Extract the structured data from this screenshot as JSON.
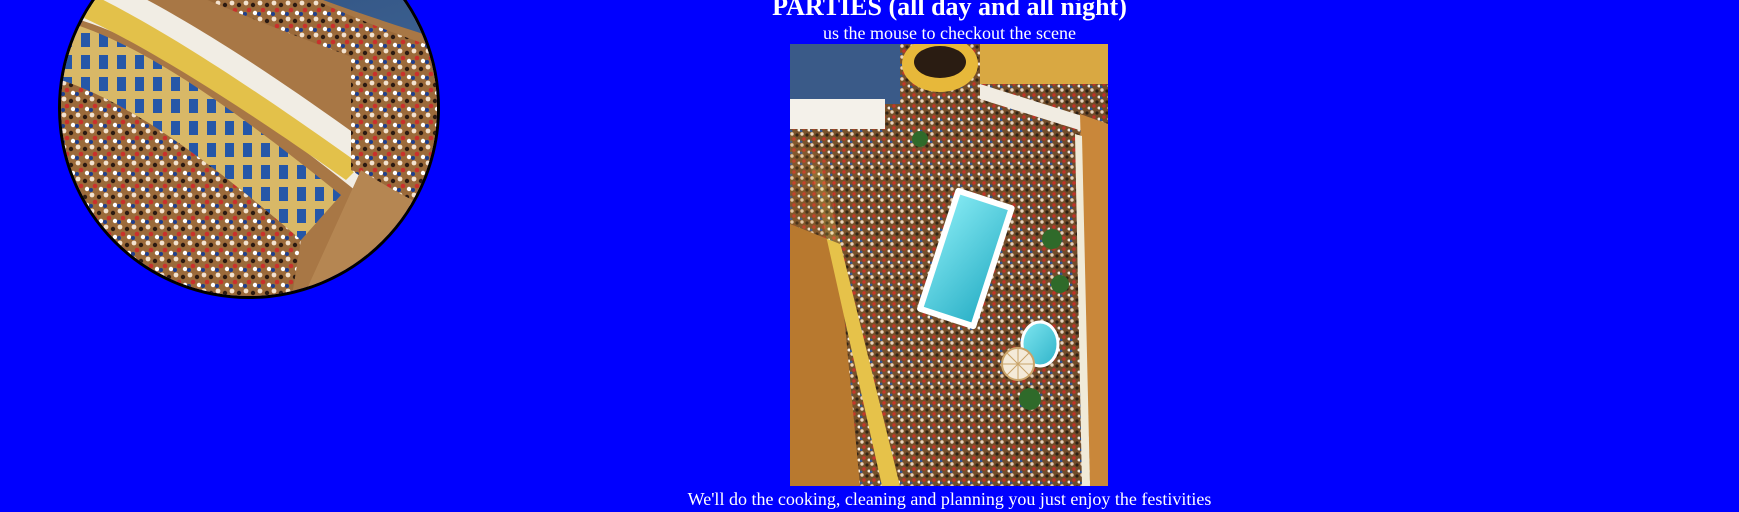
{
  "page": {
    "background_color": "#0000ff",
    "text_color": "#ffffff"
  },
  "header": {
    "title": "PARTIES (all day and all night)",
    "instruction": "us the mouse to checkout the scene"
  },
  "gallery": {
    "image_subject": "aerial view of crowded cruise ship pool deck party",
    "magnifier_border_color": "#000000"
  },
  "footer": {
    "caption": "We'll do the cooking, cleaning and planning you just enjoy the festivities"
  }
}
